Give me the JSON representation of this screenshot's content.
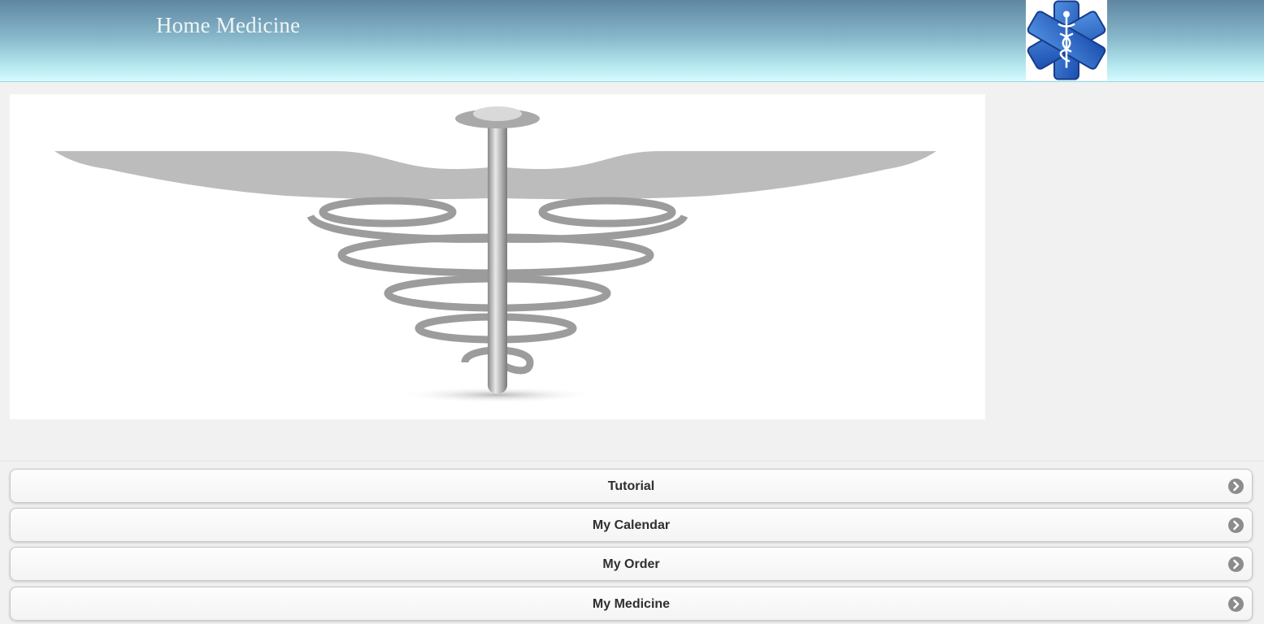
{
  "header": {
    "title": "Home Medicine",
    "logo_icon": "star-of-life-caduceus-icon",
    "gradient": [
      "#5f86a3",
      "#d4fbfd"
    ]
  },
  "banner": {
    "image": "caduceus-image"
  },
  "menu": {
    "items": [
      {
        "label": "Tutorial",
        "icon": "chevron-right-circle-icon"
      },
      {
        "label": "My Calendar",
        "icon": "chevron-right-circle-icon"
      },
      {
        "label": "My Order",
        "icon": "chevron-right-circle-icon"
      },
      {
        "label": "My Medicine",
        "icon": "chevron-right-circle-icon"
      }
    ]
  }
}
